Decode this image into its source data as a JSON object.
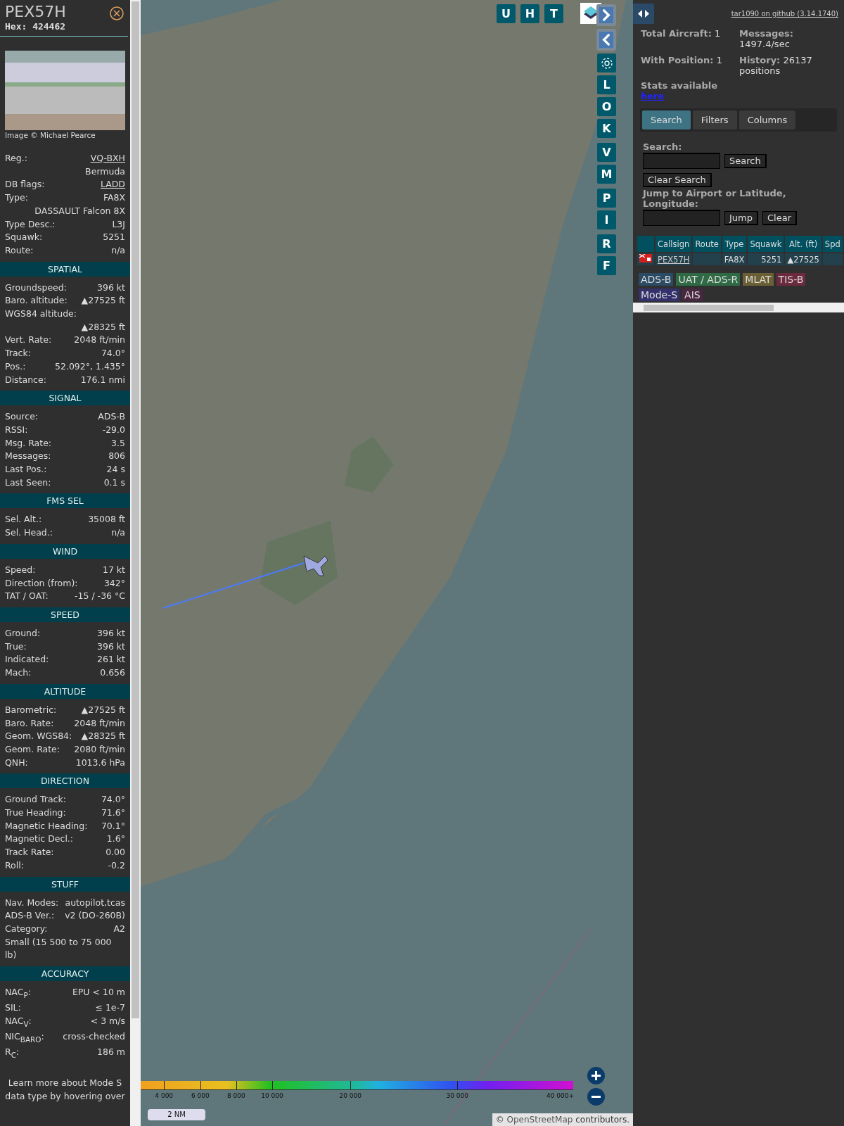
{
  "aircraft_panel": {
    "callsign": "PEX57H",
    "hex": "Hex: 424462",
    "photo_credit": "Image © Michael Pearce",
    "sections": [
      {
        "rows": [
          {
            "kind": "pair",
            "label": "Reg.:",
            "value": "VQ-BXH",
            "link": true
          },
          {
            "kind": "value",
            "value": "Bermuda"
          },
          {
            "kind": "pair",
            "label": "DB flags:",
            "value": "LADD",
            "link": true
          },
          {
            "kind": "pair",
            "label": "Type:",
            "value": "FA8X"
          },
          {
            "kind": "value",
            "value": "DASSAULT Falcon 8X"
          },
          {
            "kind": "pair",
            "label": "Type Desc.:",
            "value": "L3J"
          },
          {
            "kind": "pair",
            "label": "Squawk:",
            "value": "5251"
          },
          {
            "kind": "pair",
            "label": "Route:",
            "value": "n/a"
          }
        ]
      },
      {
        "title": "SPATIAL",
        "rows": [
          {
            "kind": "pair",
            "label": "Groundspeed:",
            "value": "396 kt"
          },
          {
            "kind": "pair",
            "label": "Baro. altitude:",
            "value": "▲27525 ft"
          },
          {
            "kind": "note",
            "value": "WGS84 altitude:"
          },
          {
            "kind": "value",
            "value": "▲28325 ft"
          },
          {
            "kind": "pair",
            "label": "Vert. Rate:",
            "value": "2048 ft/min"
          },
          {
            "kind": "pair",
            "label": "Track:",
            "value": "74.0°"
          },
          {
            "kind": "pair",
            "label": "Pos.:",
            "value": "52.092°, 1.435°"
          },
          {
            "kind": "pair",
            "label": "Distance:",
            "value": "176.1 nmi"
          }
        ]
      },
      {
        "title": "SIGNAL",
        "rows": [
          {
            "kind": "pair",
            "label": "Source:",
            "value": "ADS-B"
          },
          {
            "kind": "pair",
            "label": "RSSI:",
            "value": "-29.0"
          },
          {
            "kind": "pair",
            "label": "Msg. Rate:",
            "value": "3.5"
          },
          {
            "kind": "pair",
            "label": "Messages:",
            "value": "806"
          },
          {
            "kind": "pair",
            "label": "Last Pos.:",
            "value": "24 s"
          },
          {
            "kind": "pair",
            "label": "Last Seen:",
            "value": "0.1 s"
          }
        ]
      },
      {
        "title": "FMS SEL",
        "rows": [
          {
            "kind": "pair",
            "label": "Sel. Alt.:",
            "value": "35008 ft"
          },
          {
            "kind": "pair",
            "label": "Sel. Head.:",
            "value": "n/a"
          }
        ]
      },
      {
        "title": "WIND",
        "rows": [
          {
            "kind": "pair",
            "label": "Speed:",
            "value": "17 kt"
          },
          {
            "kind": "pair",
            "label": "Direction (from):",
            "value": "342°"
          },
          {
            "kind": "pair",
            "label": "TAT / OAT:",
            "value": "-15 / -36 °C"
          }
        ]
      },
      {
        "title": "SPEED",
        "rows": [
          {
            "kind": "pair",
            "label": "Ground:",
            "value": "396 kt"
          },
          {
            "kind": "pair",
            "label": "True:",
            "value": "396 kt"
          },
          {
            "kind": "pair",
            "label": "Indicated:",
            "value": "261 kt"
          },
          {
            "kind": "pair",
            "label": "Mach:",
            "value": "0.656"
          }
        ]
      },
      {
        "title": "ALTITUDE",
        "rows": [
          {
            "kind": "pair",
            "label": "Barometric:",
            "value": "▲27525 ft"
          },
          {
            "kind": "pair",
            "label": "Baro. Rate:",
            "value": "2048 ft/min"
          },
          {
            "kind": "pair",
            "label": "Geom. WGS84:",
            "value": "▲28325 ft"
          },
          {
            "kind": "pair",
            "label": "Geom. Rate:",
            "value": "2080 ft/min"
          },
          {
            "kind": "pair",
            "label": "QNH:",
            "value": "1013.6 hPa"
          }
        ]
      },
      {
        "title": "DIRECTION",
        "rows": [
          {
            "kind": "pair",
            "label": "Ground Track:",
            "value": "74.0°"
          },
          {
            "kind": "pair",
            "label": "True Heading:",
            "value": "71.6°"
          },
          {
            "kind": "pair",
            "label": "Magnetic Heading:",
            "value": "70.1°"
          },
          {
            "kind": "pair",
            "label": "Magnetic Decl.:",
            "value": "1.6°"
          },
          {
            "kind": "pair",
            "label": "Track Rate:",
            "value": "0.00"
          },
          {
            "kind": "pair",
            "label": "Roll:",
            "value": "-0.2"
          }
        ]
      },
      {
        "title": "STUFF",
        "rows": [
          {
            "kind": "pair",
            "label": "Nav. Modes:",
            "value": "autopilot,tcas"
          },
          {
            "kind": "pair",
            "label": "ADS-B Ver.:",
            "value": "v2 (DO-260B)"
          },
          {
            "kind": "pair",
            "label": "Category:",
            "value": "A2"
          },
          {
            "kind": "note",
            "value": "Small (15 500 to 75 000 lb)"
          }
        ]
      },
      {
        "title": "ACCURACY",
        "rows": [
          {
            "kind": "pair",
            "label": "NAC$_{P}$:",
            "value": "EPU < 10 m"
          },
          {
            "kind": "pair",
            "label": "SIL:",
            "value": "≤ 1e-7"
          },
          {
            "kind": "pair",
            "label": "NAC$_{V}$:",
            "value": "< 3 m/s"
          },
          {
            "kind": "pair",
            "label": "NIC$_{BARO}$:",
            "value": "cross-checked"
          },
          {
            "kind": "pair",
            "label": "R$_{C}$:",
            "value": "186 m"
          }
        ]
      }
    ],
    "footer": "Learn more about Mode S data type by hovering over"
  },
  "map": {
    "top_buttons": [
      "U",
      "H",
      "T"
    ],
    "side_button_groups": [
      [
        {
          "kind": "next"
        },
        {
          "kind": "prev"
        },
        {
          "kind": "settings"
        },
        {
          "kind": "letter",
          "label": "L"
        },
        {
          "kind": "letter",
          "label": "O"
        },
        {
          "kind": "letter",
          "label": "K"
        }
      ],
      [
        {
          "kind": "letter",
          "label": "V"
        },
        {
          "kind": "letter",
          "label": "M"
        }
      ],
      [
        {
          "kind": "letter",
          "label": "P"
        },
        {
          "kind": "letter",
          "label": "I"
        }
      ],
      [
        {
          "kind": "letter",
          "label": "R"
        },
        {
          "kind": "letter",
          "label": "F"
        }
      ]
    ],
    "altitude_legend": [
      "4 000",
      "6 000",
      "8 000",
      "10 000",
      "20 000",
      "30 000",
      "40 000+"
    ],
    "scale": "2 NM",
    "attribution": {
      "prefix": "©",
      "link": "OpenStreetMap",
      "suffix": "contributors."
    }
  },
  "right_panel": {
    "version_link": "tar1090 on github (3.14.1740)",
    "stats": [
      "**Total Aircraft:** 1",
      "**Messages:** 1497.4/sec",
      "**With Position:** 1",
      "**History:** 26137 positions"
    ],
    "stats_note": {
      "text": "Stats available",
      "link": "here"
    },
    "tabs": [
      {
        "label": "Search",
        "selected": true
      },
      {
        "label": "Filters",
        "selected": false
      },
      {
        "label": "Columns",
        "selected": false
      }
    ],
    "search": {
      "label": "Search:",
      "button": "Search",
      "clear": "Clear Search",
      "jump_label": "Jump to Airport or Latitude, Longitude:",
      "jump": "Jump",
      "jump_clear": "Clear"
    },
    "table": {
      "columns": [
        "Callsign",
        "Route",
        "Type",
        "Squawk",
        "Alt. (ft)",
        "Spd"
      ],
      "rows": [
        {
          "callsign": "PEX57H",
          "route": "",
          "type": "FA8X",
          "squawk": "5251",
          "altitude": "▲27525",
          "speed": ""
        }
      ]
    },
    "sources": [
      {
        "label": "ADS-B",
        "color": "#2b4a63"
      },
      {
        "label": "UAT / ADS-R",
        "color": "#2f6a45"
      },
      {
        "label": "MLAT",
        "color": "#6b6035"
      },
      {
        "label": "TIS-B",
        "color": "#6b2a3d"
      },
      {
        "label": "Mode-S",
        "color": "#34306b"
      },
      {
        "label": "AIS",
        "color": "#4a2740"
      }
    ]
  }
}
